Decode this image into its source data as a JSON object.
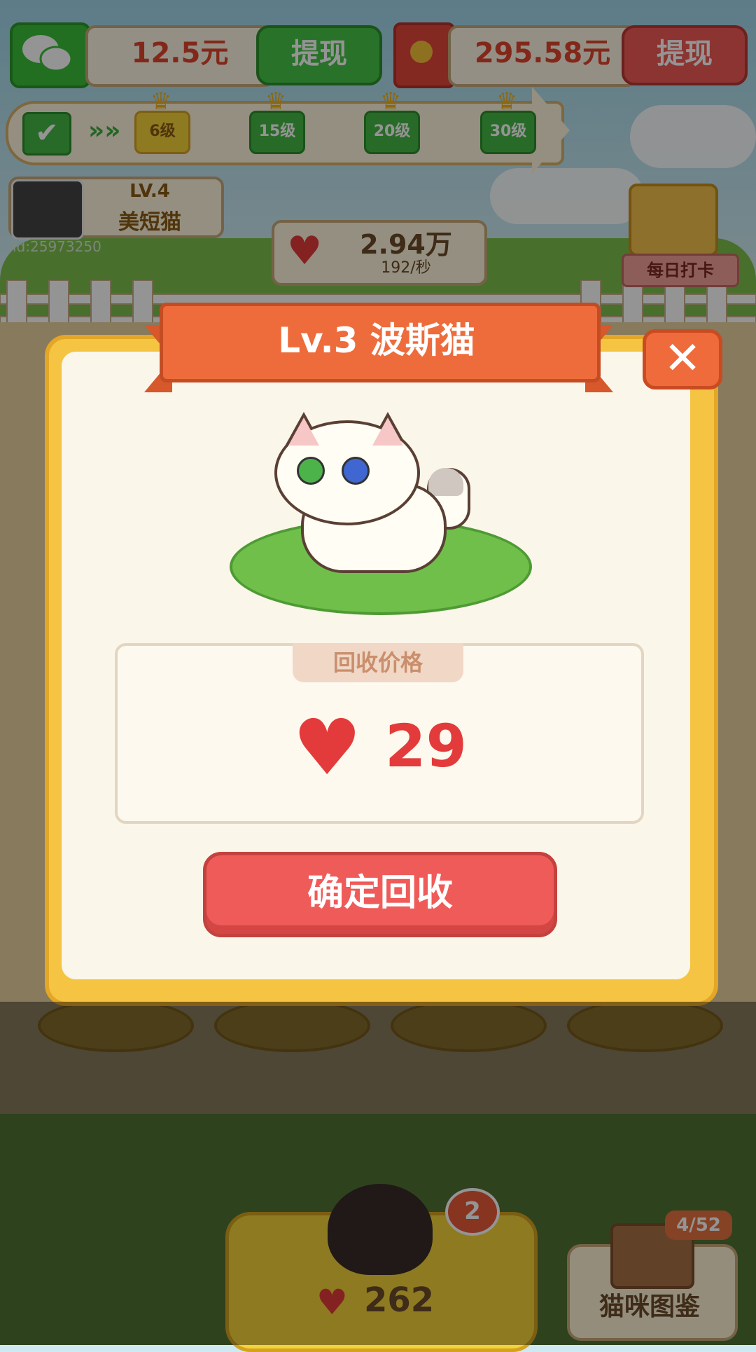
{
  "top_bar": {
    "wallet_wechat": {
      "value": "12.5元",
      "button": "提现"
    },
    "wallet_redpack": {
      "value": "295.58元",
      "button": "提现"
    }
  },
  "progress": {
    "levels": [
      "6级",
      "15级",
      "20级",
      "30级"
    ],
    "current_index": 0
  },
  "profile": {
    "level": "LV.4",
    "name": "美短猫",
    "user_id": "id:25973250"
  },
  "hearts": {
    "total": "2.94万",
    "rate": "192/秒"
  },
  "daily_checkin": {
    "label": "每日打卡"
  },
  "modal": {
    "title": "Lv.3 波斯猫",
    "price_label": "回收价格",
    "price_value": "29",
    "confirm_label": "确定回收",
    "close_icon": "close-icon"
  },
  "bottom": {
    "buy_badge": "2",
    "buy_price": "262",
    "album_count": "4/52",
    "album_label": "猫咪图鉴"
  },
  "colors": {
    "accent_red": "#e33b3b",
    "button_green": "#47c447",
    "modal_gold": "#f6c443",
    "ribbon_orange": "#ee6c3c"
  }
}
